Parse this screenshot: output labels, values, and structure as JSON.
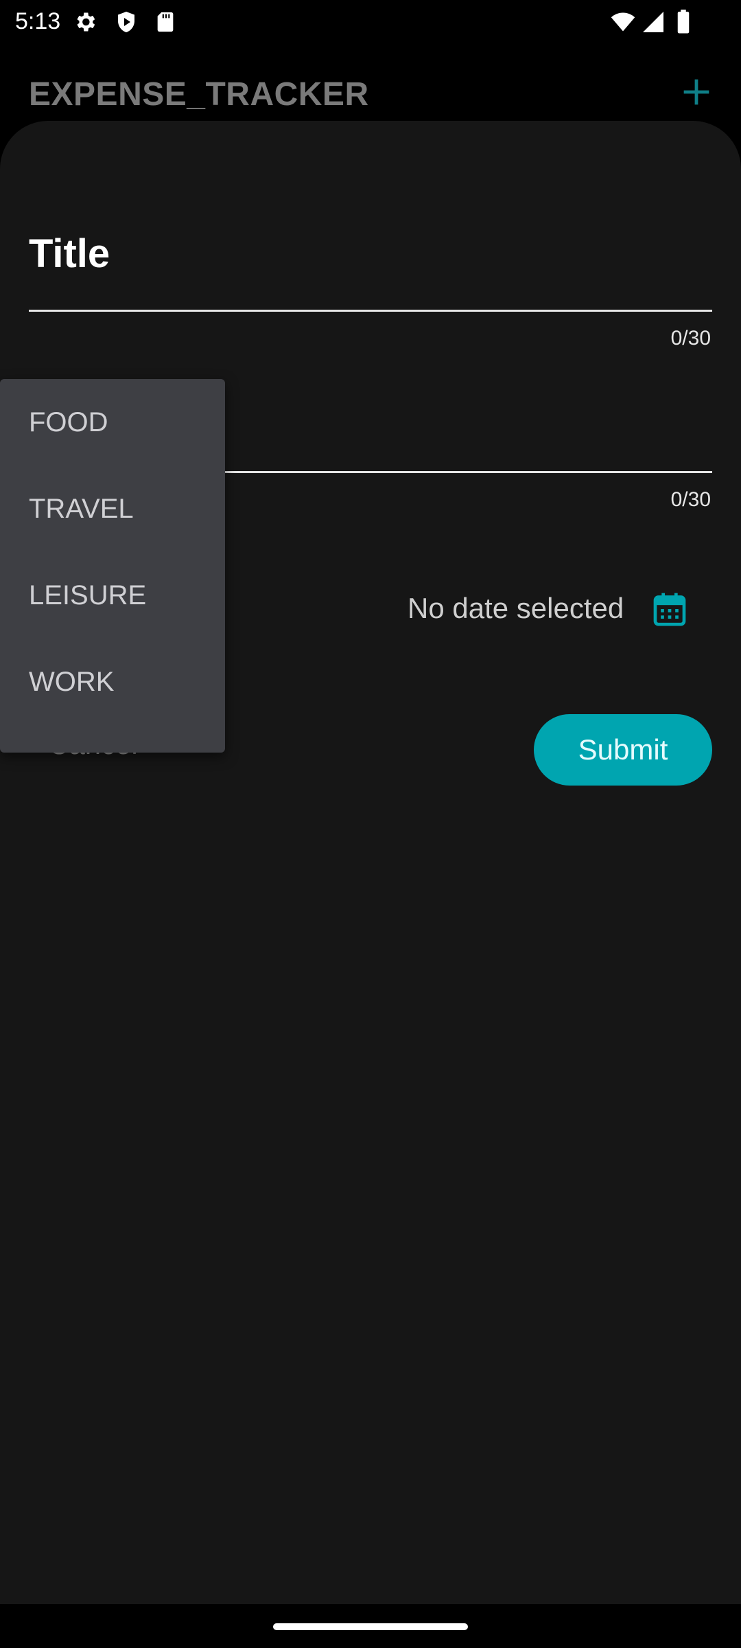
{
  "status_bar": {
    "time": "5:13",
    "icons": [
      "gear-icon",
      "shield-icon",
      "sd-card-icon",
      "wifi-icon",
      "signal-icon",
      "battery-icon"
    ]
  },
  "app_bar": {
    "title": "EXPENSE_TRACKER",
    "add_icon": "plus-icon"
  },
  "form": {
    "title_label": "Title",
    "title_counter": "0/30",
    "amount_counter": "0/30",
    "date_text": "No date selected",
    "calendar_icon": "calendar-icon",
    "cancel_label": "Cancel",
    "submit_label": "Submit"
  },
  "dropdown": {
    "items": [
      {
        "label": "FOOD"
      },
      {
        "label": "TRAVEL"
      },
      {
        "label": "LEISURE"
      },
      {
        "label": "WORK"
      }
    ]
  },
  "colors": {
    "accent": "#00a5b0",
    "sheet_background": "#161616",
    "menu_background": "#3e3f44"
  }
}
